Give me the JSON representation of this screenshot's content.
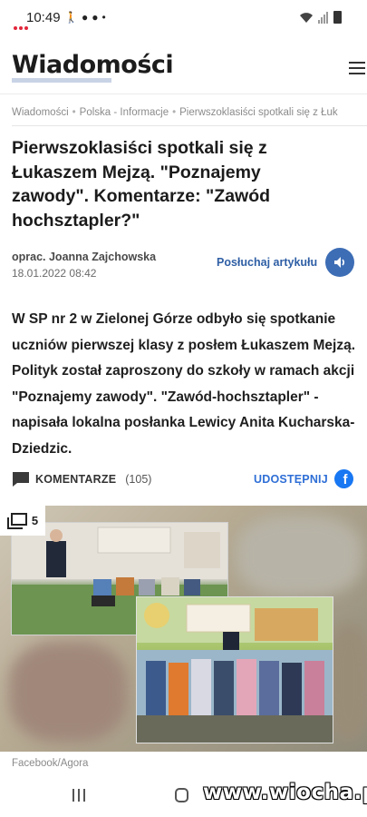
{
  "status_bar": {
    "time": "10:49"
  },
  "header": {
    "logo": "Wiadomości"
  },
  "breadcrumb": [
    "Wiadomości",
    "Polska - Informacje",
    "Pierwszoklasiści spotkali się z Łuk"
  ],
  "article": {
    "title": "Pierwszoklasiści spotkali się z Łukaszem Mejzą. \"Poznajemy zawody\". Komentarze: \"Zawód hochsztapler?\"",
    "author": "oprac. Joanna Zajchowska",
    "date": "18.01.2022 08:42",
    "listen_label": "Posłuchaj artykułu",
    "lead": "W SP nr 2 w Zielonej Górze odbyło się spotkanie uczniów pierwszej klasy z posłem Łukaszem Mejzą. Polityk został zaproszony do szkoły w ramach akcji \"Poznajemy zawody\". \"Zawód-hochsztapler\" - napisała lokalna posłanka Lewicy Anita Kucharska-Dziedzic.",
    "comments_label": "KOMENTARZE",
    "comments_count": "(105)",
    "share_label": "UDOSTĘPNIJ",
    "photo_count": "5",
    "photo_caption": "Facebook/Agora"
  },
  "watermark": "www.wiocha.pl",
  "colors": {
    "accent_blue": "#2f5fa5",
    "share_blue": "#2f6fd6",
    "facebook_blue": "#1877f2",
    "logo_underline": "#c9d3e6"
  },
  "icons": {
    "menu": "hamburger-icon",
    "listen": "speaker-icon",
    "comments": "comment-bubble-icon",
    "share": "facebook-icon",
    "gallery": "gallery-stack-icon"
  }
}
